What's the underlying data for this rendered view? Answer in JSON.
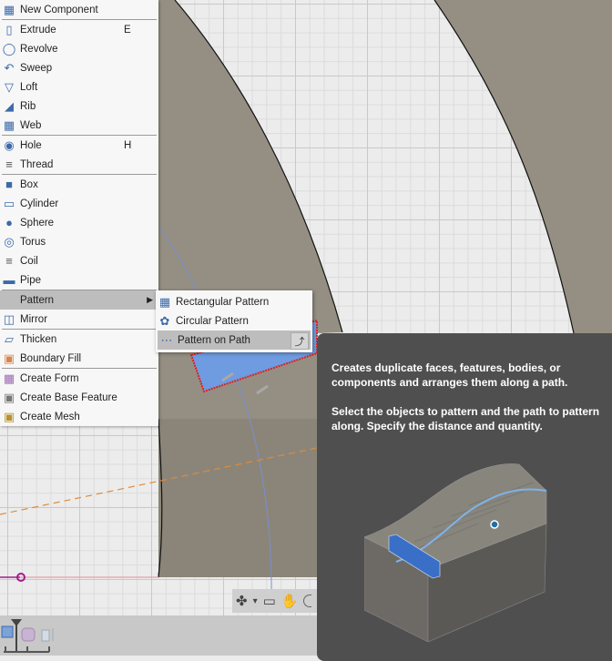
{
  "menu": {
    "items": [
      {
        "label": "New Component",
        "icon": "new-component-icon",
        "shortcut": ""
      },
      {
        "label": "Extrude",
        "icon": "extrude-icon",
        "shortcut": "E"
      },
      {
        "label": "Revolve",
        "icon": "revolve-icon",
        "shortcut": ""
      },
      {
        "label": "Sweep",
        "icon": "sweep-icon",
        "shortcut": ""
      },
      {
        "label": "Loft",
        "icon": "loft-icon",
        "shortcut": ""
      },
      {
        "label": "Rib",
        "icon": "rib-icon",
        "shortcut": ""
      },
      {
        "label": "Web",
        "icon": "web-icon",
        "shortcut": ""
      },
      {
        "label": "Hole",
        "icon": "hole-icon",
        "shortcut": "H"
      },
      {
        "label": "Thread",
        "icon": "thread-icon",
        "shortcut": ""
      },
      {
        "label": "Box",
        "icon": "box-icon",
        "shortcut": ""
      },
      {
        "label": "Cylinder",
        "icon": "cylinder-icon",
        "shortcut": ""
      },
      {
        "label": "Sphere",
        "icon": "sphere-icon",
        "shortcut": ""
      },
      {
        "label": "Torus",
        "icon": "torus-icon",
        "shortcut": ""
      },
      {
        "label": "Coil",
        "icon": "coil-icon",
        "shortcut": ""
      },
      {
        "label": "Pipe",
        "icon": "pipe-icon",
        "shortcut": ""
      },
      {
        "label": "Pattern",
        "icon": "",
        "shortcut": "",
        "has_submenu": true,
        "active": true
      },
      {
        "label": "Mirror",
        "icon": "mirror-icon",
        "shortcut": ""
      },
      {
        "label": "Thicken",
        "icon": "thicken-icon",
        "shortcut": ""
      },
      {
        "label": "Boundary Fill",
        "icon": "boundary-fill-icon",
        "shortcut": ""
      },
      {
        "label": "Create Form",
        "icon": "create-form-icon",
        "shortcut": ""
      },
      {
        "label": "Create Base Feature",
        "icon": "create-base-feature-icon",
        "shortcut": ""
      },
      {
        "label": "Create Mesh",
        "icon": "create-mesh-icon",
        "shortcut": ""
      }
    ]
  },
  "submenu": {
    "items": [
      {
        "label": "Rectangular Pattern",
        "icon": "rectangular-pattern-icon"
      },
      {
        "label": "Circular Pattern",
        "icon": "circular-pattern-icon"
      },
      {
        "label": "Pattern on Path",
        "icon": "pattern-on-path-icon",
        "active": true
      }
    ]
  },
  "tooltip": {
    "description": "Creates duplicate faces, features, bodies, or components and arranges them along a path.",
    "instructions": "Select the objects to pattern and the path to pattern along. Specify the distance and quantity."
  },
  "nav_toolbar": {
    "orbit": "✤",
    "dropdown": "▾",
    "look_at": "▭",
    "pan": "✋"
  },
  "colors": {
    "menu_active": "#bdbdbd",
    "tooltip_bg": "#4f4f4f",
    "body_fill": "#958f83",
    "selection_red": "#e0201b",
    "face_blue": "#6f9be0"
  }
}
